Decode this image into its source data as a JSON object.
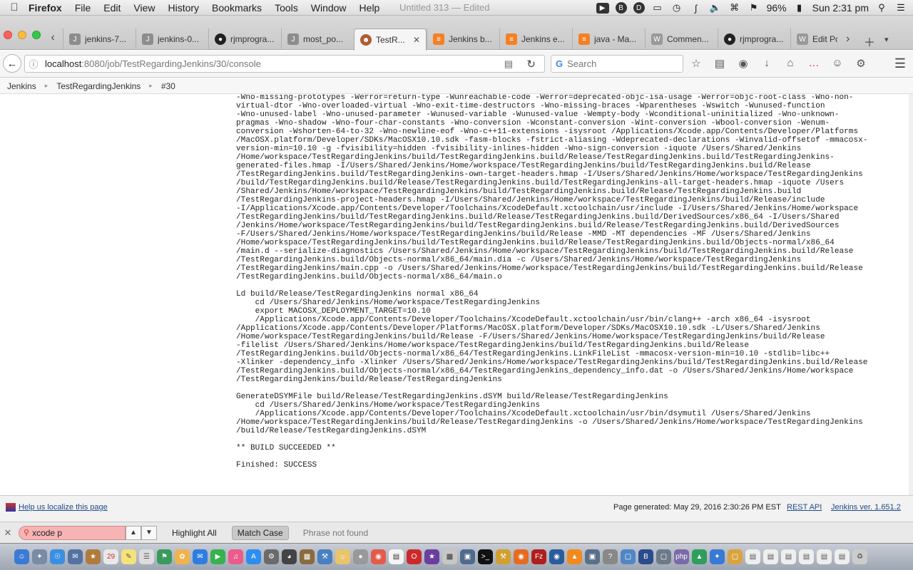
{
  "menubar": {
    "app_name": "Firefox",
    "items": [
      "File",
      "Edit",
      "View",
      "History",
      "Bookmarks",
      "Tools",
      "Window",
      "Help"
    ],
    "window_title": "Untitled 313 — Edited",
    "battery": "96%",
    "clock": "Sun 2:31 pm"
  },
  "tabs": [
    {
      "label": "jenkins-7...",
      "icon": "jenkins-icon",
      "active": false
    },
    {
      "label": "jenkins-0...",
      "icon": "jenkins-icon",
      "active": false
    },
    {
      "label": "rjmprogra...",
      "icon": "github-icon",
      "active": false
    },
    {
      "label": "most_po...",
      "icon": "jenkins-icon",
      "active": false
    },
    {
      "label": "TestR...",
      "icon": "user-avatar-icon",
      "active": true
    },
    {
      "label": "Jenkins b...",
      "icon": "stackoverflow-icon",
      "active": false
    },
    {
      "label": "Jenkins e...",
      "icon": "stackoverflow-icon",
      "active": false
    },
    {
      "label": "java - Ma...",
      "icon": "stackoverflow-icon",
      "active": false
    },
    {
      "label": "Commen...",
      "icon": "wordpress-icon",
      "active": false
    },
    {
      "label": "rjmprogra...",
      "icon": "github-icon",
      "active": false
    },
    {
      "label": "Edit Post",
      "icon": "wordpress-icon",
      "active": false
    }
  ],
  "navbar": {
    "url_host": "localhost",
    "url_rest": ":8080/job/TestRegardingJenkins/30/console",
    "search_placeholder": "Search"
  },
  "breadcrumb": [
    "Jenkins",
    "TestRegardingJenkins",
    "#30"
  ],
  "console": {
    "text": "-Wno-missing-prototypes -Werror=return-type -Wunreachable-code -Werror=deprecated-objc-isa-usage -Werror=objc-root-class -Wno-non-\nvirtual-dtor -Wno-overloaded-virtual -Wno-exit-time-destructors -Wno-missing-braces -Wparentheses -Wswitch -Wunused-function\n-Wno-unused-label -Wno-unused-parameter -Wunused-variable -Wunused-value -Wempty-body -Wconditional-uninitialized -Wno-unknown-\npragmas -Wno-shadow -Wno-four-char-constants -Wno-conversion -Wconstant-conversion -Wint-conversion -Wbool-conversion -Wenum-\nconversion -Wshorten-64-to-32 -Wno-newline-eof -Wno-c++11-extensions -isysroot /Applications/Xcode.app/Contents/Developer/Platforms\n/MacOSX.platform/Developer/SDKs/MacOSX10.10.sdk -fasm-blocks -fstrict-aliasing -Wdeprecated-declarations -Winvalid-offsetof -mmacosx-\nversion-min=10.10 -g -fvisibility=hidden -fvisibility-inlines-hidden -Wno-sign-conversion -iquote /Users/Shared/Jenkins\n/Home/workspace/TestRegardingJenkins/build/TestRegardingJenkins.build/Release/TestRegardingJenkins.build/TestRegardingJenkins-\ngenerated-files.hmap -I/Users/Shared/Jenkins/Home/workspace/TestRegardingJenkins/build/TestRegardingJenkins.build/Release\n/TestRegardingJenkins.build/TestRegardingJenkins-own-target-headers.hmap -I/Users/Shared/Jenkins/Home/workspace/TestRegardingJenkins\n/build/TestRegardingJenkins.build/Release/TestRegardingJenkins.build/TestRegardingJenkins-all-target-headers.hmap -iquote /Users\n/Shared/Jenkins/Home/workspace/TestRegardingJenkins/build/TestRegardingJenkins.build/Release/TestRegardingJenkins.build\n/TestRegardingJenkins-project-headers.hmap -I/Users/Shared/Jenkins/Home/workspace/TestRegardingJenkins/build/Release/include\n-I/Applications/Xcode.app/Contents/Developer/Toolchains/XcodeDefault.xctoolchain/usr/include -I/Users/Shared/Jenkins/Home/workspace\n/TestRegardingJenkins/build/TestRegardingJenkins.build/Release/TestRegardingJenkins.build/DerivedSources/x86_64 -I/Users/Shared\n/Jenkins/Home/workspace/TestRegardingJenkins/build/TestRegardingJenkins.build/Release/TestRegardingJenkins.build/DerivedSources\n-F/Users/Shared/Jenkins/Home/workspace/TestRegardingJenkins/build/Release -MMD -MT dependencies -MF /Users/Shared/Jenkins\n/Home/workspace/TestRegardingJenkins/build/TestRegardingJenkins.build/Release/TestRegardingJenkins.build/Objects-normal/x86_64\n/main.d --serialize-diagnostics /Users/Shared/Jenkins/Home/workspace/TestRegardingJenkins/build/TestRegardingJenkins.build/Release\n/TestRegardingJenkins.build/Objects-normal/x86_64/main.dia -c /Users/Shared/Jenkins/Home/workspace/TestRegardingJenkins\n/TestRegardingJenkins/main.cpp -o /Users/Shared/Jenkins/Home/workspace/TestRegardingJenkins/build/TestRegardingJenkins.build/Release\n/TestRegardingJenkins.build/Objects-normal/x86_64/main.o\n\nLd build/Release/TestRegardingJenkins normal x86_64\n    cd /Users/Shared/Jenkins/Home/workspace/TestRegardingJenkins\n    export MACOSX_DEPLOYMENT_TARGET=10.10\n    /Applications/Xcode.app/Contents/Developer/Toolchains/XcodeDefault.xctoolchain/usr/bin/clang++ -arch x86_64 -isysroot\n/Applications/Xcode.app/Contents/Developer/Platforms/MacOSX.platform/Developer/SDKs/MacOSX10.10.sdk -L/Users/Shared/Jenkins\n/Home/workspace/TestRegardingJenkins/build/Release -F/Users/Shared/Jenkins/Home/workspace/TestRegardingJenkins/build/Release\n-filelist /Users/Shared/Jenkins/Home/workspace/TestRegardingJenkins/build/TestRegardingJenkins.build/Release\n/TestRegardingJenkins.build/Objects-normal/x86_64/TestRegardingJenkins.LinkFileList -mmacosx-version-min=10.10 -stdlib=libc++\n-Xlinker -dependency_info -Xlinker /Users/Shared/Jenkins/Home/workspace/TestRegardingJenkins/build/TestRegardingJenkins.build/Release\n/TestRegardingJenkins.build/Objects-normal/x86_64/TestRegardingJenkins_dependency_info.dat -o /Users/Shared/Jenkins/Home/workspace\n/TestRegardingJenkins/build/Release/TestRegardingJenkins\n\nGenerateDSYMFile build/Release/TestRegardingJenkins.dSYM build/Release/TestRegardingJenkins\n    cd /Users/Shared/Jenkins/Home/workspace/TestRegardingJenkins\n    /Applications/Xcode.app/Contents/Developer/Toolchains/XcodeDefault.xctoolchain/usr/bin/dsymutil /Users/Shared/Jenkins\n/Home/workspace/TestRegardingJenkins/build/Release/TestRegardingJenkins -o /Users/Shared/Jenkins/Home/workspace/TestRegardingJenkins\n/build/Release/TestRegardingJenkins.dSYM\n\n** BUILD SUCCEEDED **\n\nFinished: SUCCESS"
  },
  "footer": {
    "localize": "Help us localize this page",
    "generated": "Page generated: May 29, 2016 2:30:26 PM EST",
    "rest_api": "REST API",
    "version": "Jenkins ver. 1.651.2"
  },
  "findbar": {
    "query": "xcode p",
    "highlight_all": "Highlight All",
    "match_case": "Match Case",
    "status": "Phrase not found"
  },
  "colors": {
    "find_not_found_bg": "#f7b4b4",
    "link": "#204a87"
  }
}
